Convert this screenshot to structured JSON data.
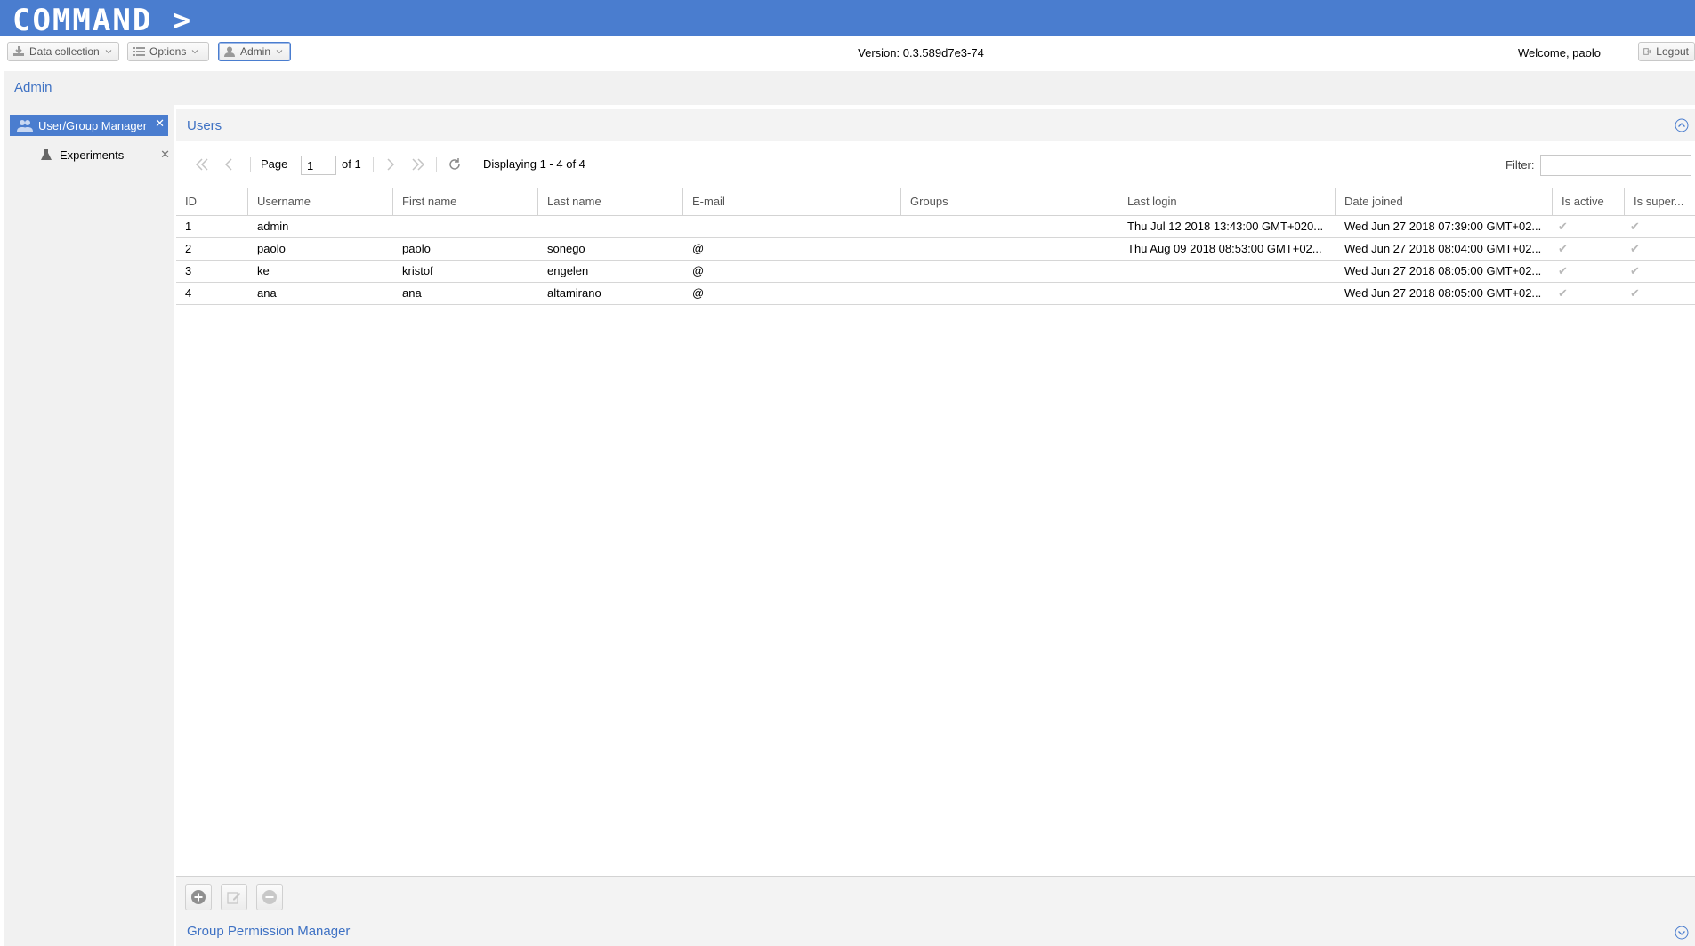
{
  "app": {
    "logo_text": "COMMAND >_"
  },
  "topbar": {
    "menus": [
      {
        "label": "Data collection",
        "icon": "download-icon"
      },
      {
        "label": "Options",
        "icon": "list-icon"
      },
      {
        "label": "Admin",
        "icon": "user-icon"
      }
    ],
    "version": "Version: 0.3.589d7e3-74",
    "welcome": "Welcome, paolo",
    "logout_label": "Logout"
  },
  "admin_title": "Admin",
  "sidebar": {
    "items": [
      {
        "label": "User/Group Manager",
        "icon": "users-icon",
        "selected": true
      },
      {
        "label": "Experiments",
        "icon": "flask-icon",
        "selected": false
      }
    ]
  },
  "users_panel": {
    "title": "Users",
    "pager": {
      "page_label": "Page",
      "page_value": "1",
      "of_label": "of 1",
      "display_text": "Displaying 1 - 4 of 4"
    },
    "filter_label": "Filter:",
    "filter_value": "",
    "columns": [
      "ID",
      "Username",
      "First name",
      "Last name",
      "E-mail",
      "Groups",
      "Last login",
      "Date joined",
      "Is active",
      "Is super..."
    ],
    "rows": [
      [
        "1",
        "admin",
        "",
        "",
        "",
        "",
        "Thu Jul 12 2018 13:43:00 GMT+020...",
        "Wed Jun 27 2018 07:39:00 GMT+02...",
        "✔",
        "✔"
      ],
      [
        "2",
        "paolo",
        "paolo",
        "sonego",
        "@",
        "",
        "Thu Aug 09 2018 08:53:00 GMT+02...",
        "Wed Jun 27 2018 08:04:00 GMT+02...",
        "✔",
        "✔"
      ],
      [
        "3",
        "ke",
        "kristof",
        "engelen",
        "@",
        "",
        "",
        "Wed Jun 27 2018 08:05:00 GMT+02...",
        "✔",
        "✔"
      ],
      [
        "4",
        "ana",
        "ana",
        "altamirano",
        "@",
        "",
        "",
        "Wed Jun 27 2018 08:05:00 GMT+02...",
        "✔",
        "✔"
      ]
    ]
  },
  "group_permission_panel": {
    "title": "Group Permission Manager"
  },
  "colors": {
    "banner": "#4a7dcf",
    "accent_text": "#3f72c4",
    "panel_bg": "#f3f3f3"
  }
}
